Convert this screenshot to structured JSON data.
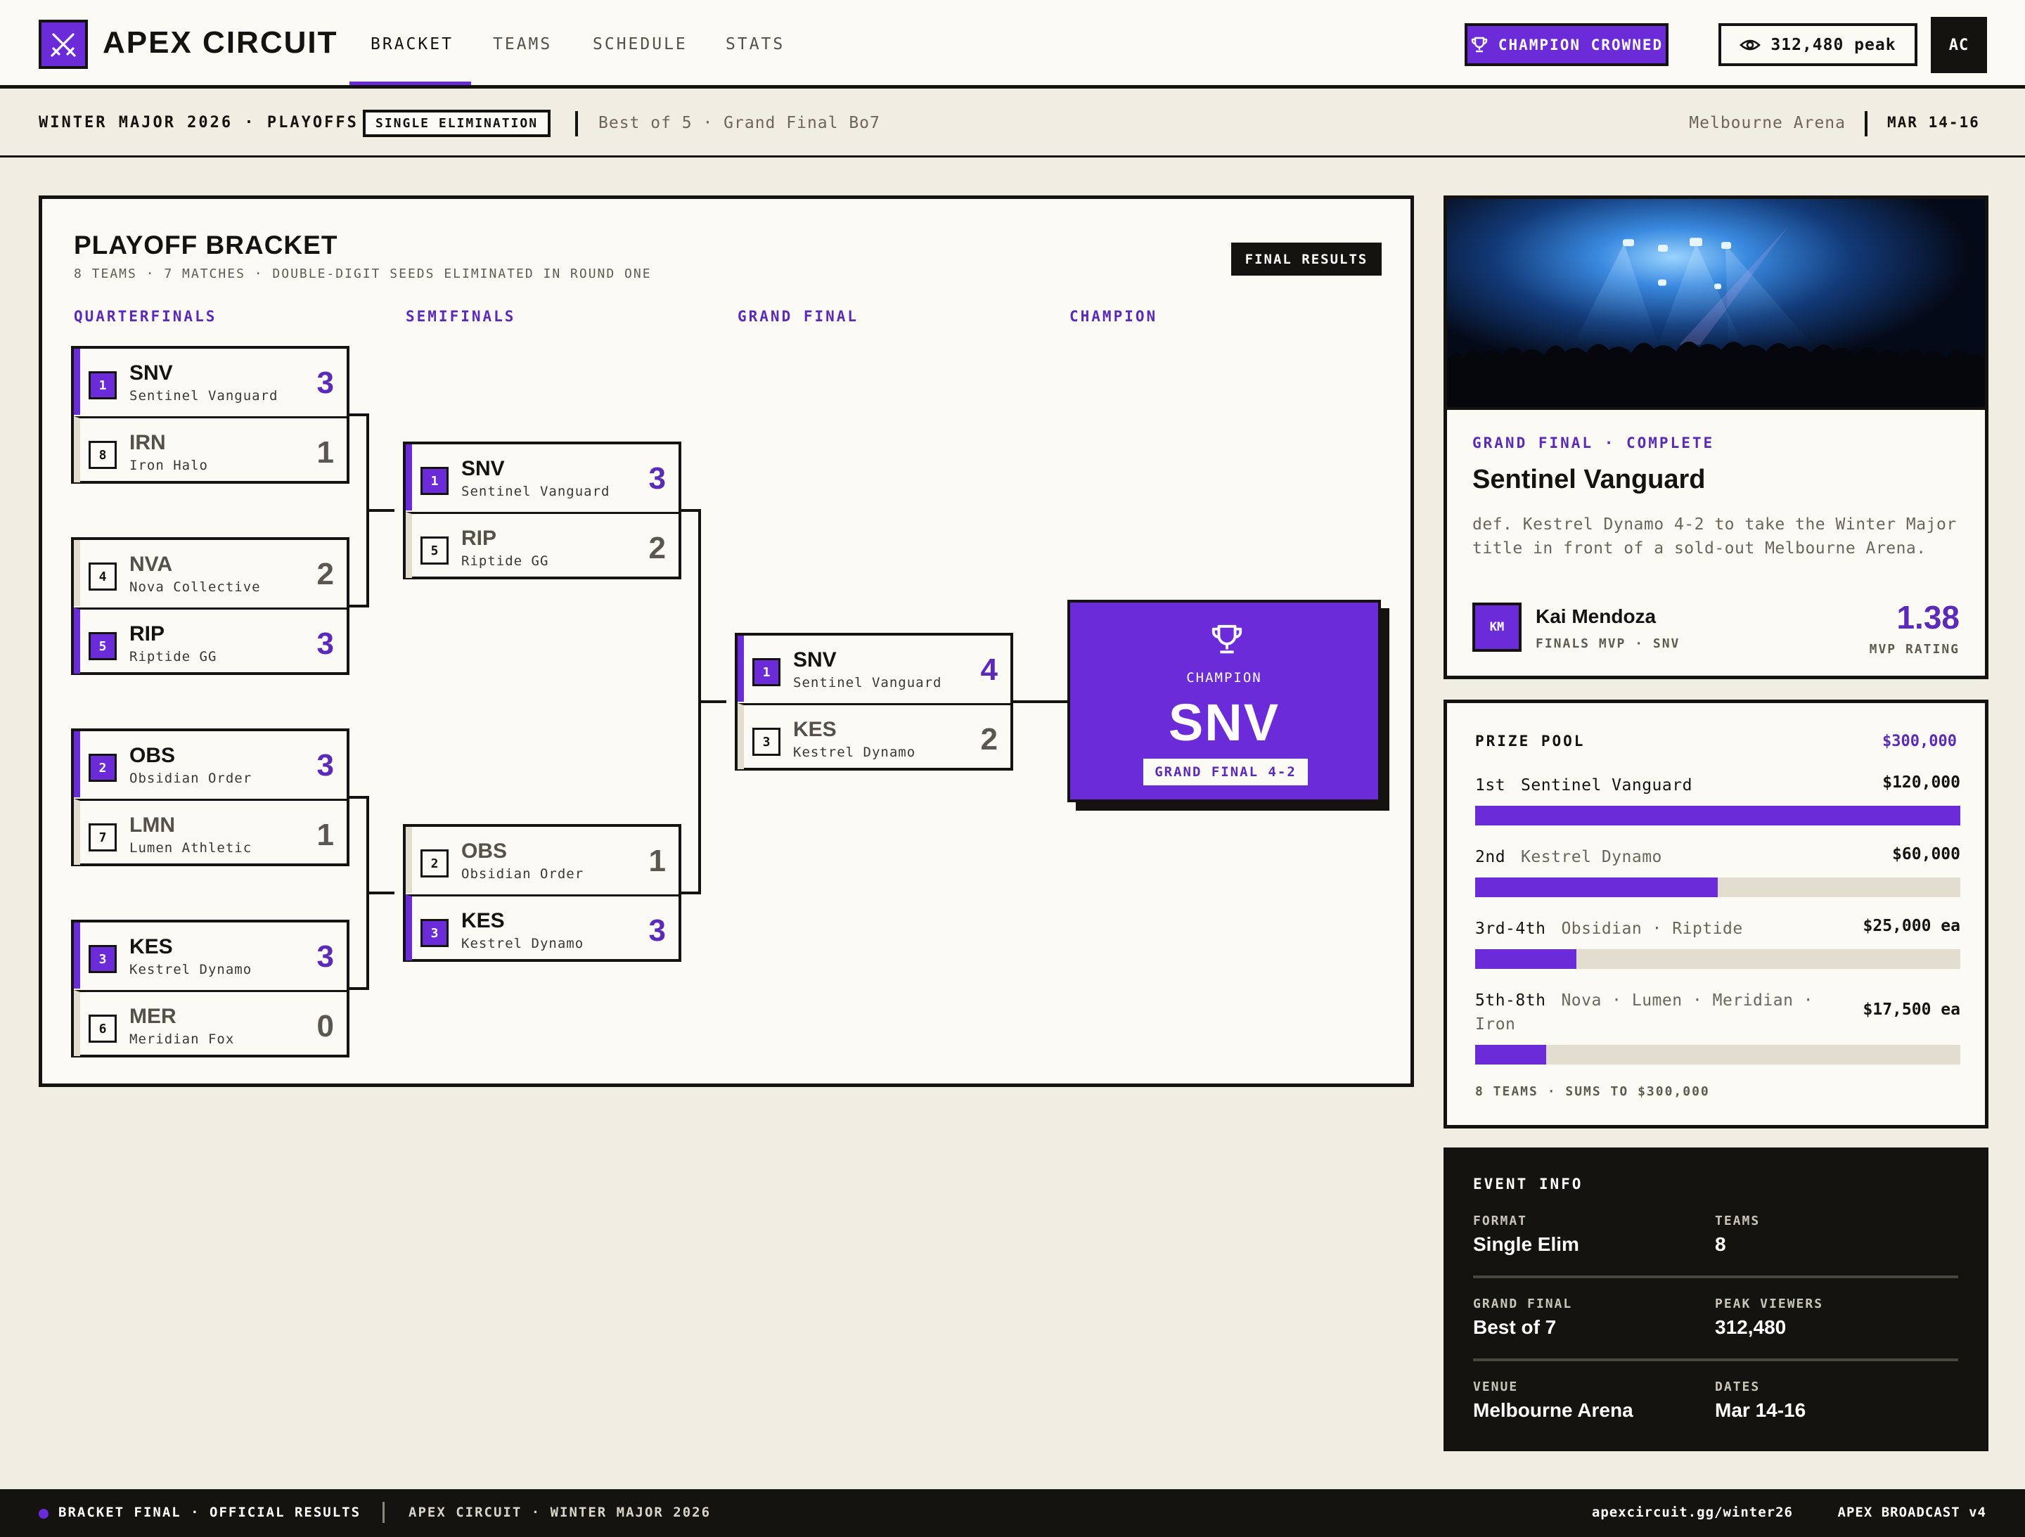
{
  "app": {
    "brand": "APEX CIRCUIT",
    "avatar_initials": "AC"
  },
  "nav": {
    "tabs": [
      "BRACKET",
      "TEAMS",
      "SCHEDULE",
      "STATS"
    ],
    "active": "BRACKET"
  },
  "header": {
    "champion_badge": "CHAMPION CROWNED",
    "viewers_badge": "312,480 peak"
  },
  "subbar": {
    "event": "WINTER MAJOR 2026 · PLAYOFFS",
    "format_tag": "SINGLE ELIMINATION",
    "series": "Best of 5 · Grand Final Bo7",
    "venue": "Melbourne Arena",
    "dates": "MAR 14-16"
  },
  "bracket": {
    "title": "PLAYOFF BRACKET",
    "subtitle": "8 TEAMS · 7 MATCHES · DOUBLE-DIGIT SEEDS ELIMINATED IN ROUND ONE",
    "tag": "FINAL RESULTS",
    "rounds": [
      "QUARTERFINALS",
      "SEMIFINALS",
      "GRAND FINAL",
      "CHAMPION"
    ],
    "quarterfinals": [
      {
        "t1": {
          "seed": "1",
          "abbr": "SNV",
          "name": "Sentinel Vanguard",
          "score": "3",
          "winner": true
        },
        "t2": {
          "seed": "8",
          "abbr": "IRN",
          "name": "Iron Halo",
          "score": "1",
          "winner": false
        }
      },
      {
        "t1": {
          "seed": "4",
          "abbr": "NVA",
          "name": "Nova Collective",
          "score": "2",
          "winner": false
        },
        "t2": {
          "seed": "5",
          "abbr": "RIP",
          "name": "Riptide GG",
          "score": "3",
          "winner": true
        }
      },
      {
        "t1": {
          "seed": "2",
          "abbr": "OBS",
          "name": "Obsidian Order",
          "score": "3",
          "winner": true
        },
        "t2": {
          "seed": "7",
          "abbr": "LMN",
          "name": "Lumen Athletic",
          "score": "1",
          "winner": false
        }
      },
      {
        "t1": {
          "seed": "3",
          "abbr": "KES",
          "name": "Kestrel Dynamo",
          "score": "3",
          "winner": true
        },
        "t2": {
          "seed": "6",
          "abbr": "MER",
          "name": "Meridian Fox",
          "score": "0",
          "winner": false
        }
      }
    ],
    "semifinals": [
      {
        "t1": {
          "seed": "1",
          "abbr": "SNV",
          "name": "Sentinel Vanguard",
          "score": "3",
          "winner": true
        },
        "t2": {
          "seed": "5",
          "abbr": "RIP",
          "name": "Riptide GG",
          "score": "2",
          "winner": false
        }
      },
      {
        "t1": {
          "seed": "2",
          "abbr": "OBS",
          "name": "Obsidian Order",
          "score": "1",
          "winner": false
        },
        "t2": {
          "seed": "3",
          "abbr": "KES",
          "name": "Kestrel Dynamo",
          "score": "3",
          "winner": true
        }
      }
    ],
    "final": [
      {
        "t1": {
          "seed": "1",
          "abbr": "SNV",
          "name": "Sentinel Vanguard",
          "score": "4",
          "winner": true
        },
        "t2": {
          "seed": "3",
          "abbr": "KES",
          "name": "Kestrel Dynamo",
          "score": "2",
          "winner": false
        }
      }
    ],
    "champion": {
      "label": "CHAMPION",
      "team": "SNV",
      "result": "GRAND FINAL 4-2"
    }
  },
  "feature": {
    "kicker": "GRAND FINAL · COMPLETE",
    "title": "Sentinel Vanguard",
    "description": "def. Kestrel Dynamo 4-2 to take the Winter Major title in front of a sold-out Melbourne Arena.",
    "mvp": {
      "initials": "KM",
      "name": "Kai Mendoza",
      "role": "FINALS MVP · SNV",
      "rating": "1.38",
      "rating_label": "MVP RATING"
    }
  },
  "prize_pool": {
    "title": "PRIZE POOL",
    "total": "$300,000",
    "rows": [
      {
        "place": "1st",
        "teams": "Sentinel Vanguard",
        "amount": "$120,000",
        "fraction": 1.0
      },
      {
        "place": "2nd",
        "teams": "Kestrel Dynamo",
        "amount": "$60,000",
        "fraction": 0.5
      },
      {
        "place": "3rd-4th",
        "teams": "Obsidian · Riptide",
        "amount": "$25,000 ea",
        "fraction": 0.2083
      },
      {
        "place": "5th-8th",
        "teams": "Nova · Lumen · Meridian · Iron",
        "amount": "$17,500 ea",
        "fraction": 0.1458
      }
    ],
    "footer": "8 TEAMS · SUMS TO $300,000"
  },
  "event_info": {
    "title": "EVENT INFO",
    "items": [
      {
        "label": "FORMAT",
        "value": "Single Elim"
      },
      {
        "label": "TEAMS",
        "value": "8"
      },
      {
        "label": "GRAND FINAL",
        "value": "Best of 7"
      },
      {
        "label": "PEAK VIEWERS",
        "value": "312,480"
      },
      {
        "label": "VENUE",
        "value": "Melbourne Arena"
      },
      {
        "label": "DATES",
        "value": "Mar 14-16"
      }
    ]
  },
  "footer": {
    "status": "BRACKET FINAL · OFFICIAL RESULTS",
    "event": "APEX CIRCUIT · WINTER MAJOR 2026",
    "url": "apexcircuit.gg/winter26",
    "version": "APEX BROADCAST v4"
  },
  "colors": {
    "accent": "#6b2bd9",
    "accent_text": "#5b2ab8",
    "ink": "#14130f",
    "paper": "#fbfaf4",
    "background": "#f0ede3"
  }
}
